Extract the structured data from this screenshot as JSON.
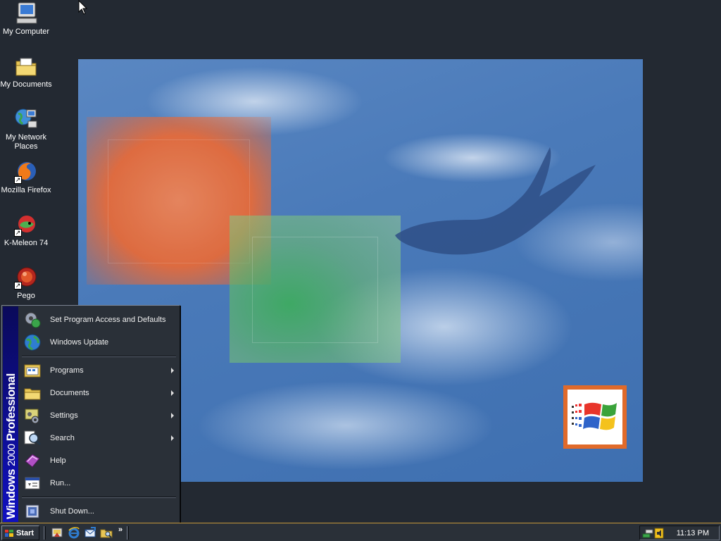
{
  "desktop": {
    "icons": [
      {
        "label": "My Computer",
        "icon": "computer-icon"
      },
      {
        "label": "My Documents",
        "icon": "folder-documents-icon"
      },
      {
        "label": "My Network Places",
        "icon": "network-places-icon"
      },
      {
        "label": "Mozilla Firefox",
        "icon": "firefox-icon"
      },
      {
        "label": "K-Meleon 74",
        "icon": "kmeleon-icon"
      },
      {
        "label": "Pego",
        "icon": "pego-icon"
      }
    ],
    "background_color": "#232932"
  },
  "start_menu": {
    "banner": {
      "brand": "Windows",
      "version": "2000",
      "edition": "Professional"
    },
    "top_items": [
      {
        "label": "Set Program Access and Defaults",
        "icon": "program-access-icon"
      },
      {
        "label": "Windows Update",
        "icon": "windows-update-icon"
      }
    ],
    "items": [
      {
        "label": "Programs",
        "icon": "programs-icon",
        "submenu": true
      },
      {
        "label": "Documents",
        "icon": "documents-icon",
        "submenu": true
      },
      {
        "label": "Settings",
        "icon": "settings-icon",
        "submenu": true
      },
      {
        "label": "Search",
        "icon": "search-icon",
        "submenu": true
      },
      {
        "label": "Help",
        "icon": "help-icon",
        "submenu": false
      },
      {
        "label": "Run...",
        "icon": "run-icon",
        "submenu": false
      }
    ],
    "shutdown": {
      "label": "Shut Down...",
      "icon": "shutdown-icon"
    }
  },
  "taskbar": {
    "start_label": "Start",
    "quick_launch": [
      "show-desktop-icon",
      "internet-explorer-icon",
      "outlook-express-icon",
      "windows-explorer-icon"
    ],
    "more_chevron": "»",
    "tray_icons": [
      "network-tray-icon",
      "volume-tray-icon"
    ],
    "clock": "11:13 PM",
    "accent": "#c89a3a"
  }
}
